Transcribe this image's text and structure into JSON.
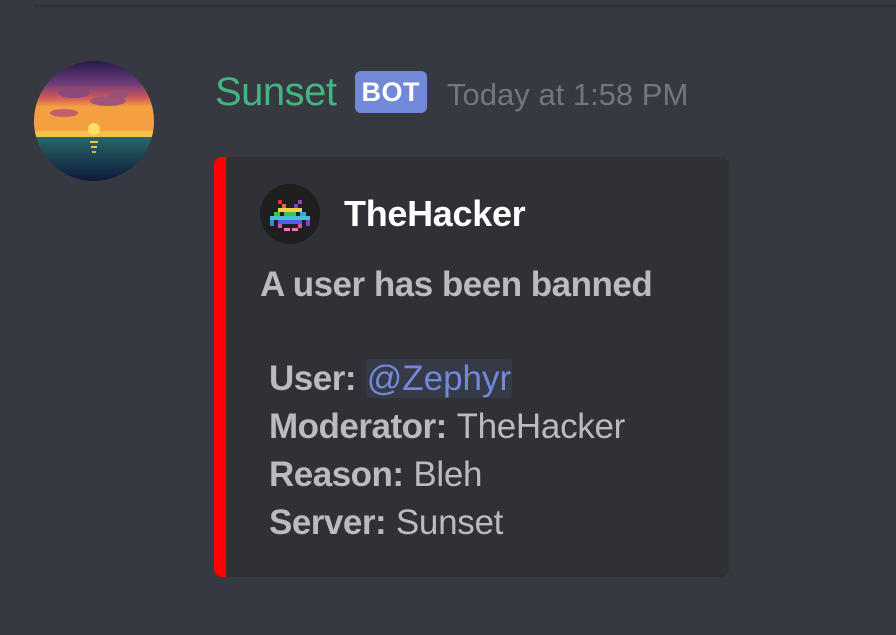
{
  "message": {
    "author_name": "Sunset",
    "bot_tag": "BOT",
    "timestamp": "Today at 1:58 PM",
    "avatar": "sunset-avatar"
  },
  "embed": {
    "accent_color": "#ff0000",
    "author": {
      "name": "TheHacker",
      "icon": "space-invader-icon"
    },
    "title": "A user has been banned",
    "fields": [
      {
        "key": "User:",
        "value": "@Zephyr",
        "is_mention": true
      },
      {
        "key": "Moderator:",
        "value": "TheHacker"
      },
      {
        "key": "Reason:",
        "value": "Bleh"
      },
      {
        "key": "Server:",
        "value": "Sunset"
      }
    ]
  },
  "colors": {
    "background": "#36393f",
    "embed_background": "#2f3136",
    "username": "#43b581",
    "bot_tag": "#7289da",
    "timestamp": "#72767d",
    "mention": "#7289da"
  }
}
